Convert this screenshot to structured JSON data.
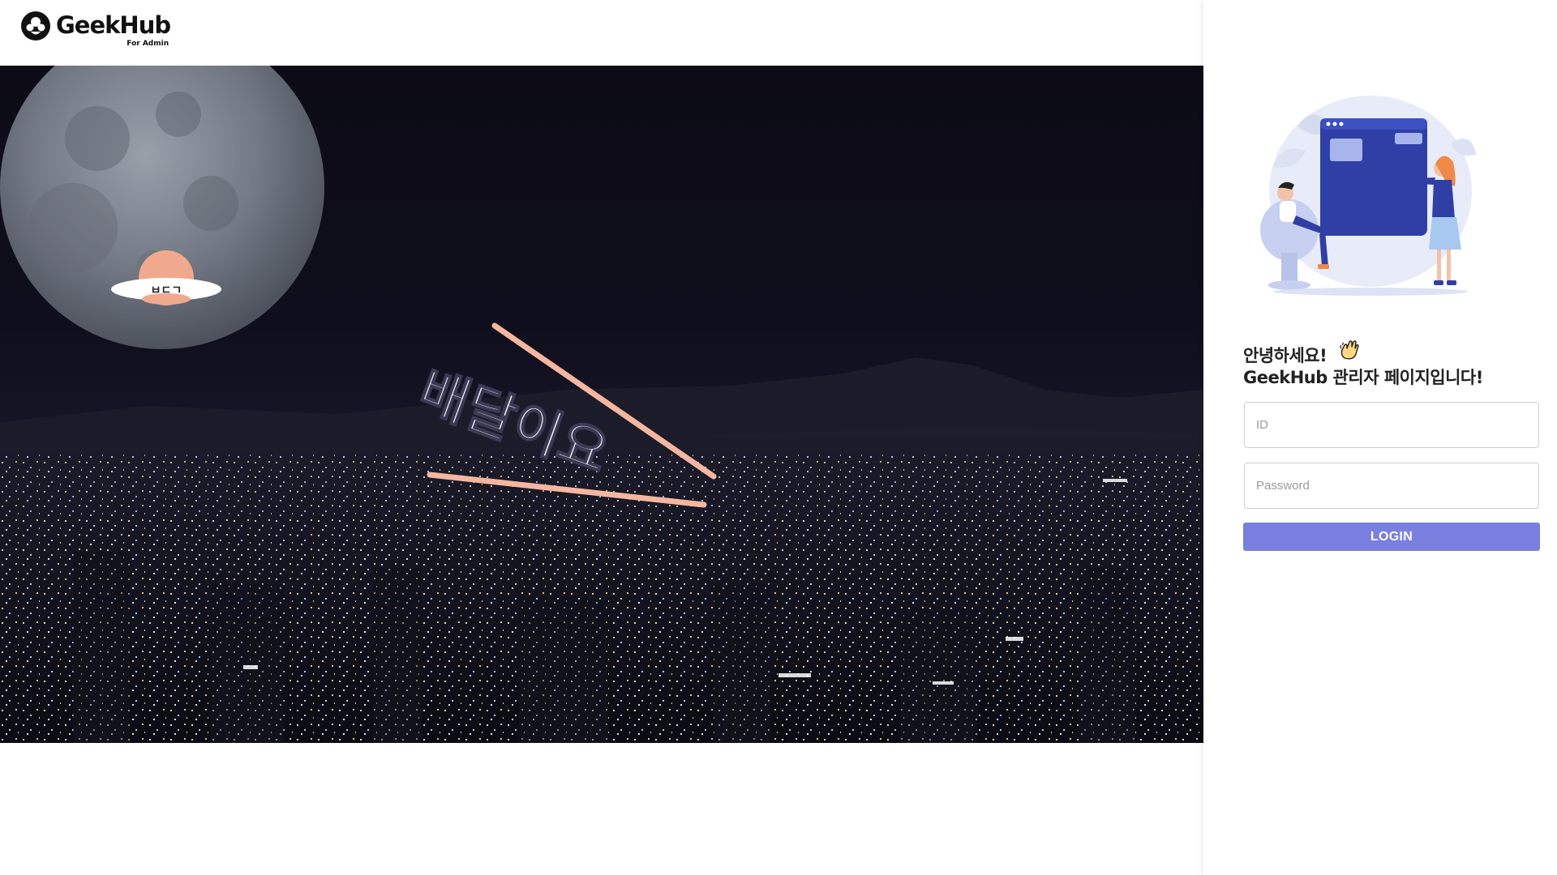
{
  "brand": {
    "name": "GeekHub",
    "subtitle": "For Admin"
  },
  "hero": {
    "banner_text": "배달이요",
    "ufo_text": "ㅂㄷㄱ"
  },
  "login": {
    "greeting_line1": "안녕하세요!",
    "greeting_line2": "GeekHub 관리자 페이지입니다!",
    "wave_icon": "waving-hand-icon",
    "id_placeholder": "ID",
    "password_placeholder": "Password",
    "login_label": "LOGIN"
  },
  "colors": {
    "accent": "#7a7fe0",
    "illustration_blue": "#2f3fa6",
    "hero_pink": "#f5b6a0"
  }
}
